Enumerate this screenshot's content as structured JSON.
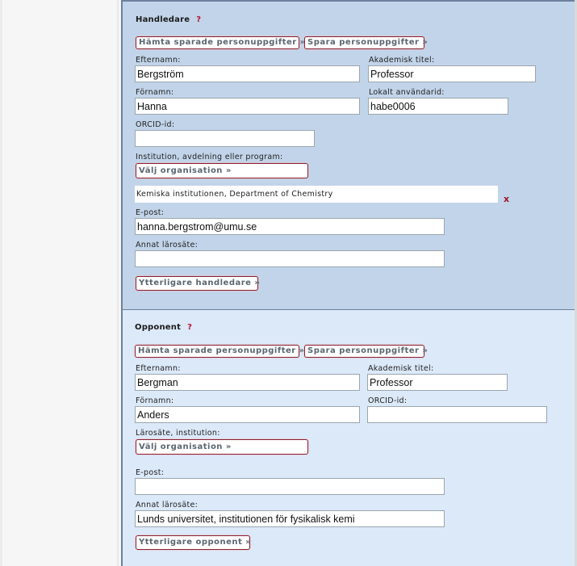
{
  "handledare": {
    "title": "Handledare",
    "help": "?",
    "fetch_button": "Hämta sparade personuppgifter »",
    "save_button": "Spara personuppgifter »",
    "efternamn_label": "Efternamn:",
    "efternamn_value": "Bergström",
    "titel_label": "Akademisk titel:",
    "titel_value": "Professor",
    "fornamn_label": "Förnamn:",
    "fornamn_value": "Hanna",
    "userid_label": "Lokalt användarid:",
    "userid_value": "habe0006",
    "orcid_label": "ORCID-id:",
    "orcid_value": "",
    "institution_label": "Institution, avdelning eller program:",
    "choose_org_button": "Välj organisation »",
    "selected_org": "Kemiska institutionen, Department of Chemistry",
    "remove_org": "x",
    "email_label": "E-post:",
    "email_value": "hanna.bergstrom@umu.se",
    "other_uni_label": "Annat lärosäte:",
    "other_uni_value": "",
    "more_button": "Ytterligare handledare »"
  },
  "opponent": {
    "title": "Opponent",
    "help": "?",
    "fetch_button": "Hämta sparade personuppgifter »",
    "save_button": "Spara personuppgifter »",
    "efternamn_label": "Efternamn:",
    "efternamn_value": "Bergman",
    "titel_label": "Akademisk titel:",
    "titel_value": "Professor",
    "fornamn_label": "Förnamn:",
    "fornamn_value": "Anders",
    "orcid_label": "ORCID-id:",
    "orcid_value": "",
    "institution_label": "Lärosäte, institution:",
    "choose_org_button": "Välj organisation »",
    "email_label": "E-post:",
    "email_value": "",
    "other_uni_label": "Annat lärosäte:",
    "other_uni_value": "Lunds universitet, institutionen för fysikalisk kemi",
    "more_button": "Ytterligare opponent »"
  }
}
